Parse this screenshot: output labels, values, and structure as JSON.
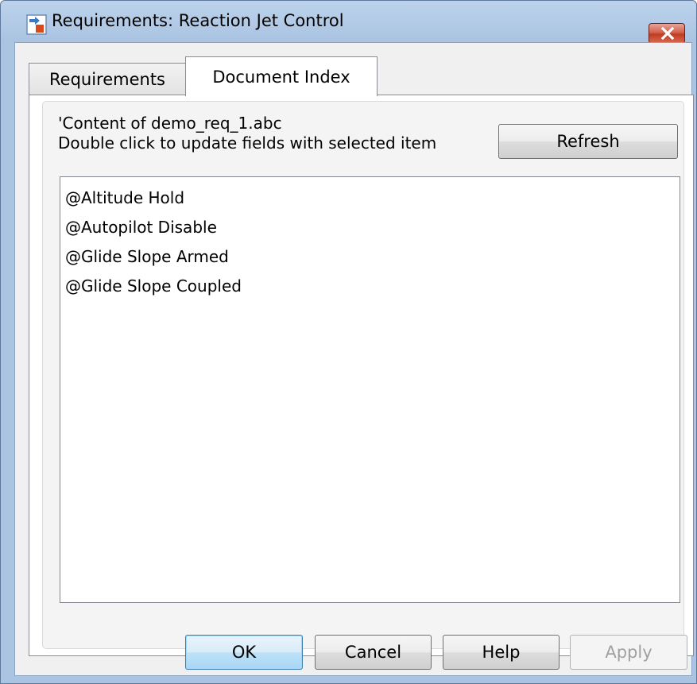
{
  "window": {
    "title": "Requirements: Reaction Jet Control",
    "icon": "simulink-model-icon",
    "close_icon": "close-icon"
  },
  "tabs": [
    {
      "label": "Requirements",
      "selected": false
    },
    {
      "label": "Document Index",
      "selected": true
    }
  ],
  "document_index": {
    "content_label": "'Content of demo_req_1.abc",
    "instruction_label": "Double click to update fields with selected item",
    "refresh_label": "Refresh",
    "items": [
      "@Altitude Hold",
      "@Autopilot Disable",
      "@Glide Slope Armed",
      "@Glide Slope Coupled"
    ]
  },
  "buttons": {
    "ok": "OK",
    "cancel": "Cancel",
    "help": "Help",
    "apply": "Apply",
    "apply_enabled": false
  }
}
